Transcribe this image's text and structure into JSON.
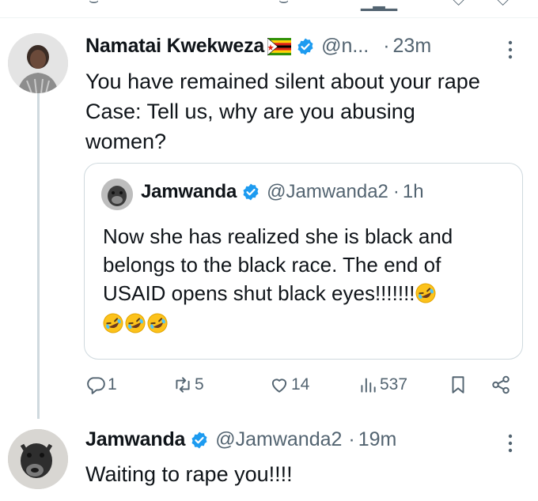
{
  "tweet1": {
    "display_name": "Namatai Kwekweza",
    "handle": "@n...",
    "time": "23m",
    "text_lines": [
      "You have remained silent about your rape",
      "Case: Tell us, why are you abusing",
      "women?"
    ]
  },
  "quote": {
    "display_name": "Jamwanda",
    "handle": "@Jamwanda2",
    "time": "1h",
    "text_lines": [
      "Now she has realized she is black and",
      "belongs to the black race. The end of",
      "USAID opens shut black eyes!!!!!!!"
    ]
  },
  "actions": {
    "replies": "1",
    "reposts": "5",
    "likes": "14",
    "views": "537"
  },
  "tweet2": {
    "display_name": "Jamwanda",
    "handle": "@Jamwanda2",
    "time": "19m",
    "text": "Waiting to rape you!!!!"
  },
  "separator": "·",
  "colors": {
    "verified": "#1d9bf0",
    "text": "#0f1419",
    "muted": "#536471",
    "border": "#cfd9de"
  },
  "icons": [
    "reply-icon",
    "repost-icon",
    "like-icon",
    "views-icon",
    "bookmark-icon",
    "share-icon",
    "more-icon",
    "verified-icon",
    "zimbabwe-flag-icon",
    "rofl-emoji"
  ]
}
